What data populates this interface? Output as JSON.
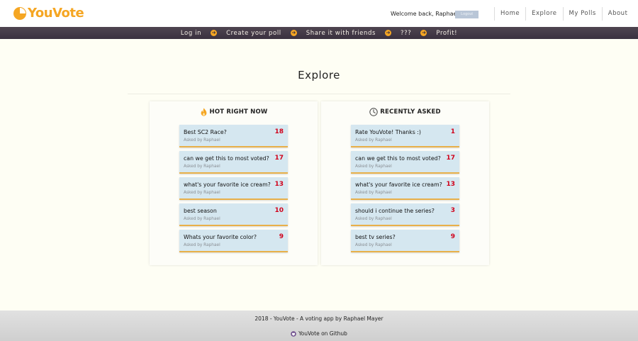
{
  "brand": {
    "name": "YouVote",
    "color": "#f5a623"
  },
  "header": {
    "welcome": "Welcome back, Raphael!",
    "logout_label": "Logout",
    "nav": [
      "Home",
      "Explore",
      "My Polls",
      "About"
    ]
  },
  "banner": {
    "steps": [
      "Log in",
      "Create your poll",
      "Share it with friends",
      "???",
      "Profit!"
    ],
    "arrow_icon": "arrow-right-circle-icon"
  },
  "main": {
    "title": "Explore",
    "hot": {
      "title": "HOT RIGHT NOW",
      "icon": "flame-icon",
      "polls": [
        {
          "question": "Best SC2 Race?",
          "asked_by": "Asked by Raphael",
          "votes": "18"
        },
        {
          "question": "can we get this to most voted?",
          "asked_by": "Asked by Raphael",
          "votes": "17"
        },
        {
          "question": "what's your favorite ice cream?",
          "asked_by": "Asked by Raphael",
          "votes": "13"
        },
        {
          "question": "best season",
          "asked_by": "Asked by Raphael",
          "votes": "10"
        },
        {
          "question": "Whats your favorite color?",
          "asked_by": "Asked by Raphael",
          "votes": "9"
        }
      ]
    },
    "recent": {
      "title": "RECENTLY ASKED",
      "icon": "clock-icon",
      "polls": [
        {
          "question": "Rate YouVote! Thanks :)",
          "asked_by": "Asked by Raphael",
          "votes": "1"
        },
        {
          "question": "can we get this to most voted?",
          "asked_by": "Asked by Raphael",
          "votes": "17"
        },
        {
          "question": "what's your favorite ice cream?",
          "asked_by": "Asked by Raphael",
          "votes": "13"
        },
        {
          "question": "should i continue the series?",
          "asked_by": "Asked by Raphael",
          "votes": "3"
        },
        {
          "question": "best tv series?",
          "asked_by": "Asked by Raphael",
          "votes": "9"
        }
      ]
    }
  },
  "footer": {
    "credit": "2018 - YouVote - A voting app by Raphael Mayer",
    "github_label": "YouVote on Github",
    "github_icon": "github-icon"
  },
  "colors": {
    "banner": "#3a3140",
    "card": "#d5e7f0",
    "vote_count": "#d0021b",
    "card_accent": "#e8b04a"
  }
}
